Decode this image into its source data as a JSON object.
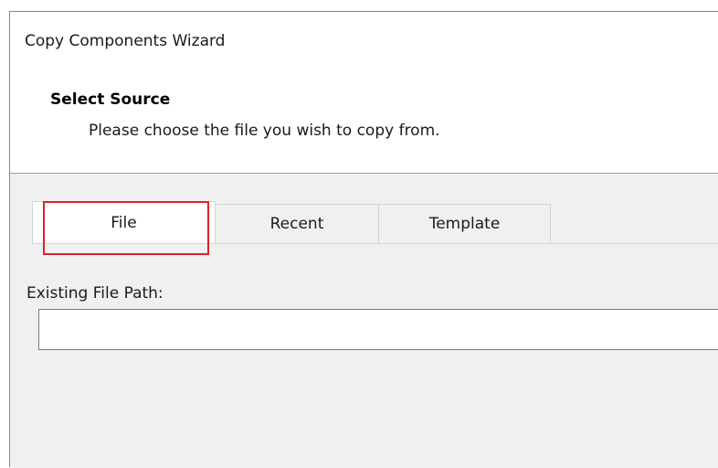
{
  "window": {
    "title": "Copy Components Wizard"
  },
  "header": {
    "title": "Select Source",
    "subtitle": "Please choose the file you wish to copy from."
  },
  "tabs": [
    {
      "label": "File",
      "active": true
    },
    {
      "label": "Recent",
      "active": false
    },
    {
      "label": "Template",
      "active": false
    }
  ],
  "file_tab": {
    "path_label": "Existing File Path:",
    "path_value": "",
    "path_placeholder": ""
  },
  "colors": {
    "highlight": "#e0202a",
    "content_bg": "#f0f0f0",
    "border": "#d4d4d4"
  }
}
